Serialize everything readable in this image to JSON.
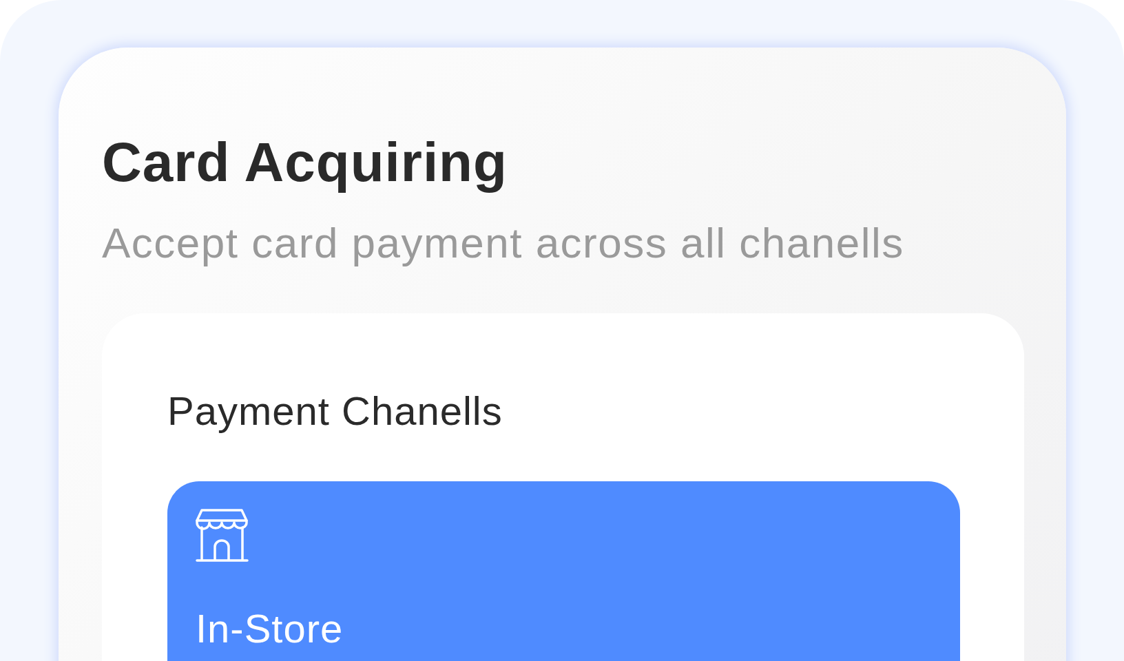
{
  "header": {
    "title": "Card Acquiring",
    "subtitle": "Accept card payment across all chanells"
  },
  "channels_panel": {
    "title": "Payment Chanells",
    "channels": [
      {
        "label": "In-Store",
        "selected": true
      }
    ]
  }
}
